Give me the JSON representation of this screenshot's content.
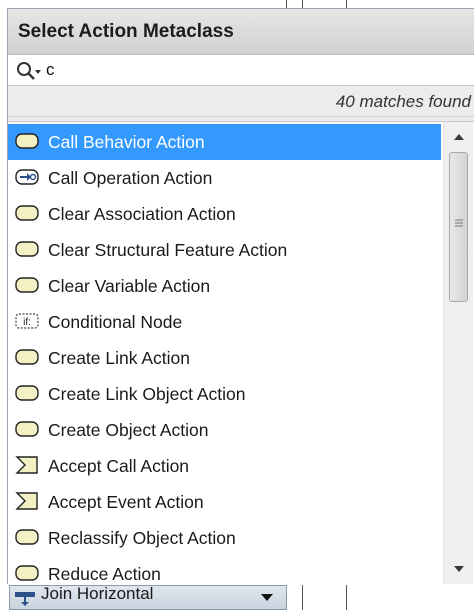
{
  "popup": {
    "title": "Select Action Metaclass",
    "search": {
      "value": "c",
      "icon": "search-dropdown-icon"
    },
    "matches_text": "40 matches found",
    "items": [
      {
        "label": "Call Behavior Action",
        "icon": "action-icon",
        "selected": true
      },
      {
        "label": "Call Operation Action",
        "icon": "call-operation-icon",
        "selected": false
      },
      {
        "label": "Clear Association Action",
        "icon": "action-icon",
        "selected": false
      },
      {
        "label": "Clear Structural Feature Action",
        "icon": "action-icon",
        "selected": false
      },
      {
        "label": "Clear Variable Action",
        "icon": "action-icon",
        "selected": false
      },
      {
        "label": "Conditional Node",
        "icon": "conditional-node-icon",
        "icon_text": "if:",
        "selected": false
      },
      {
        "label": "Create Link Action",
        "icon": "action-icon",
        "selected": false
      },
      {
        "label": "Create Link Object Action",
        "icon": "action-icon",
        "selected": false
      },
      {
        "label": "Create Object Action",
        "icon": "action-icon",
        "selected": false
      },
      {
        "label": "Accept Call Action",
        "icon": "accept-event-icon",
        "selected": false
      },
      {
        "label": "Accept Event Action",
        "icon": "accept-event-icon",
        "selected": false
      },
      {
        "label": "Reclassify Object Action",
        "icon": "action-icon",
        "selected": false
      },
      {
        "label": "Reduce Action",
        "icon": "action-icon",
        "selected": false
      }
    ]
  },
  "bottom_bar": {
    "label": "Join Horizontal",
    "icon": "join-horizontal-icon"
  },
  "colors": {
    "selection": "#3399ff",
    "action_fill": "#f3f0c4"
  }
}
